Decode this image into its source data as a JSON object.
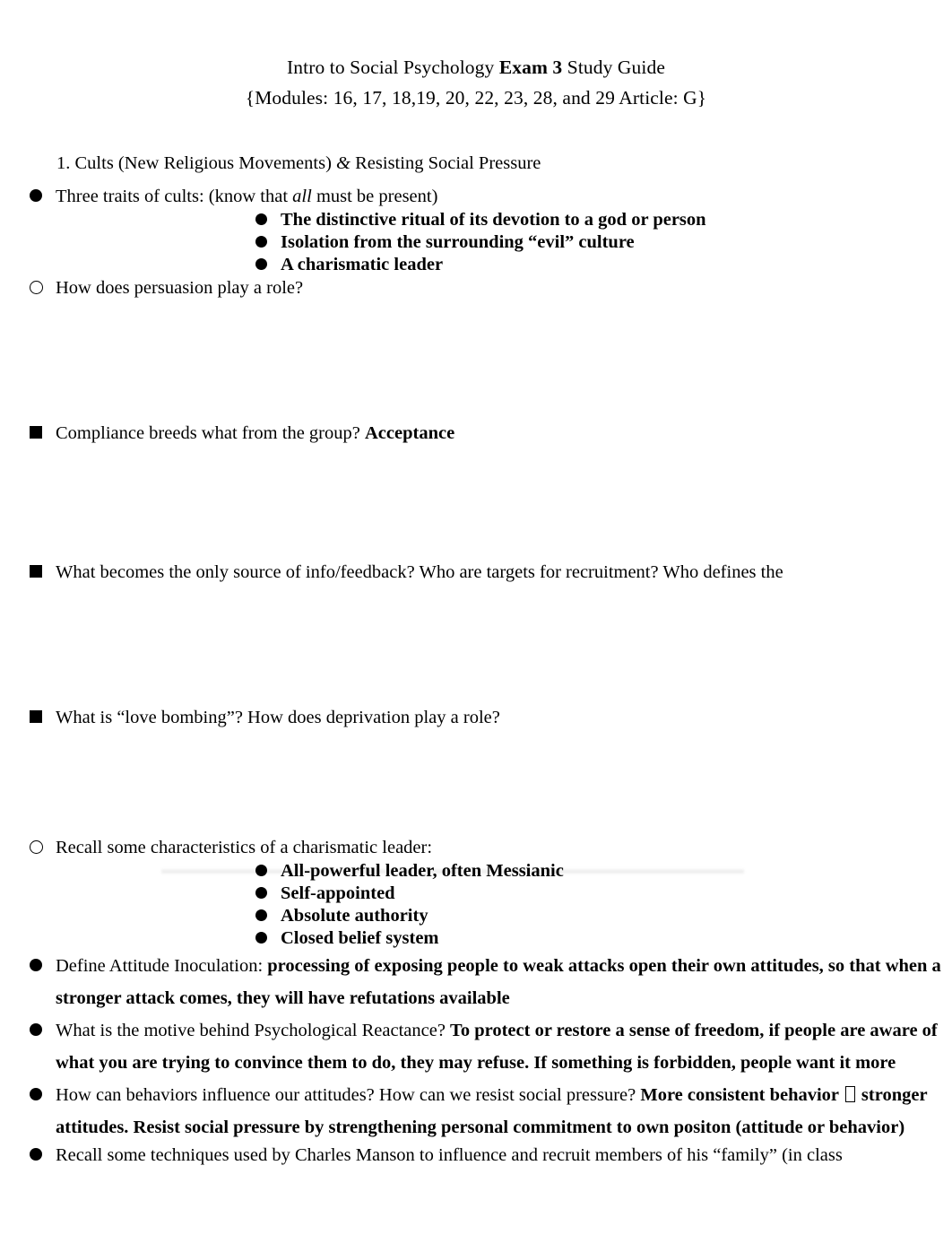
{
  "document": {
    "title_line_1_pre": "Intro to Social Psychology ",
    "title_line_1_bold": "Exam 3",
    "title_line_1_post": " Study Guide",
    "title_line_2": "{Modules: 16, 17, 18,19, 20, 22, 23, 28, and 29 Article: G}",
    "section_heading_1": "1. Cults (New Religious Movements) & Resisting Social Pressure",
    "section_heading_1_part_a": "1. Cults (New Religious Movements) ",
    "section_heading_1_amp": "&",
    "section_heading_1_part_b": " Resisting Social Pressure"
  },
  "items": {
    "three_traits": {
      "marker": "filled-circle",
      "text_pre": "Three traits of cults: (know that ",
      "text_italic": "all",
      "text_post": " must be present)"
    },
    "trait_1": {
      "marker": "filled-circle",
      "text": "The distinctive ritual of its devotion to a god or person"
    },
    "trait_2": {
      "marker": "filled-circle",
      "text": "Isolation from the surrounding “evil” culture"
    },
    "trait_3": {
      "marker": "filled-circle",
      "text": "A charismatic leader"
    },
    "persuasion": {
      "marker": "hollow-circle",
      "text": "How does persuasion play a role?"
    },
    "compliance": {
      "marker": "filled-square",
      "text_pre": "Compliance breeds what from the group? ",
      "text_bold": "Acceptance"
    },
    "source_of_info": {
      "marker": "filled-square",
      "text": "What becomes the only source of info/feedback? Who are targets for recruitment? Who defines the"
    },
    "love_bombing": {
      "marker": "filled-square",
      "text": "What is “love bombing”? How does deprivation play a role?"
    },
    "charismatic_recall": {
      "marker": "hollow-circle",
      "text": "Recall some characteristics of a charismatic leader:"
    },
    "charismatic_1": {
      "marker": "filled-circle",
      "text": "All-powerful leader, often Messianic"
    },
    "charismatic_2": {
      "marker": "filled-circle",
      "text": "Self-appointed"
    },
    "charismatic_3": {
      "marker": "filled-circle",
      "text": "Absolute authority"
    },
    "charismatic_4": {
      "marker": "filled-circle",
      "text": "Closed belief system"
    },
    "attitude_inoculation": {
      "marker": "filled-circle",
      "text_pre": "Define Attitude Inoculation: ",
      "text_bold": "processing of exposing people to weak attacks open their own attitudes, so that when a stronger attack comes, they will have refutations available"
    },
    "psychological_reactance": {
      "marker": "filled-circle",
      "text_pre": "What is the motive behind Psychological Reactance? ",
      "text_bold": "To protect or restore a sense of freedom, if people are aware of what you are trying to convince them to do, they may refuse. If something is forbidden, people want it more"
    },
    "behaviors_attitudes": {
      "marker": "filled-circle",
      "text_pre": "How can behaviors influence our attitudes?  How can we resist social pressure? ",
      "text_bold_a": "More consistent behavior ",
      "glyph": "missing-glyph-box",
      "text_bold_b": " stronger attitudes. Resist social pressure by strengthening personal commitment to own positon (attitude or behavior)"
    },
    "charles_manson": {
      "marker": "filled-circle",
      "text": "Recall some techniques used by Charles Manson to influence and recruit members of his “family” (in class"
    }
  },
  "colors": {
    "page_background": "#ffffff",
    "text": "#000000"
  }
}
